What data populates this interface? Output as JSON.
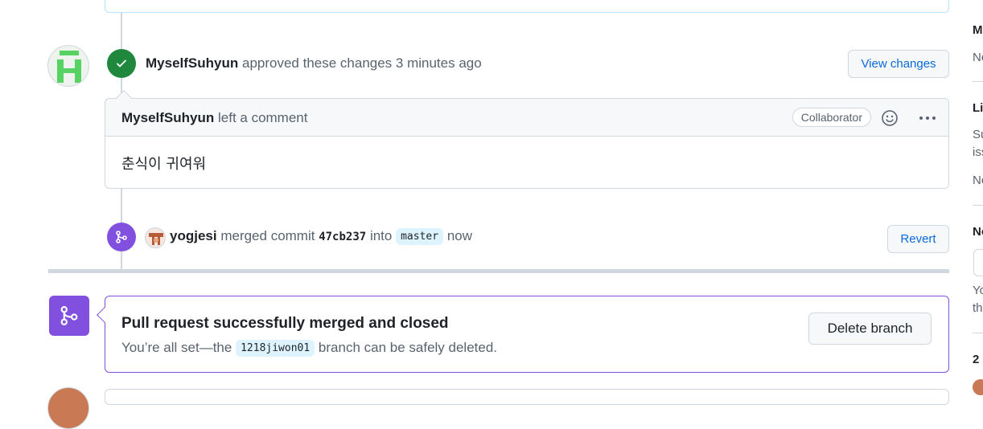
{
  "timeline": {
    "approved": {
      "user": "MyselfSuhyun",
      "action": "approved these changes 3 minutes ago",
      "button": "View changes"
    },
    "comment": {
      "user": "MyselfSuhyun",
      "action": "left a comment",
      "role_badge": "Collaborator",
      "body": "춘식이 귀여워"
    },
    "merged": {
      "user": "yogjesi",
      "action_1": "merged commit",
      "commit": "47cb237",
      "action_2": "into",
      "branch": "master",
      "time": "now",
      "button": "Revert"
    }
  },
  "merge_status": {
    "title": "Pull request successfully merged and closed",
    "message_pre": "You’re all set—the",
    "branch": "1218jiwon01",
    "message_post": "branch can be safely deleted.",
    "button": "Delete branch"
  },
  "sidebar": {
    "items": [
      "M",
      "Ne",
      "Li",
      "Su",
      "iss",
      "No",
      "No",
      "Yo",
      "th",
      "2"
    ]
  },
  "colors": {
    "approved": "#1f883d",
    "merged": "#8250df",
    "link": "#0969da"
  }
}
